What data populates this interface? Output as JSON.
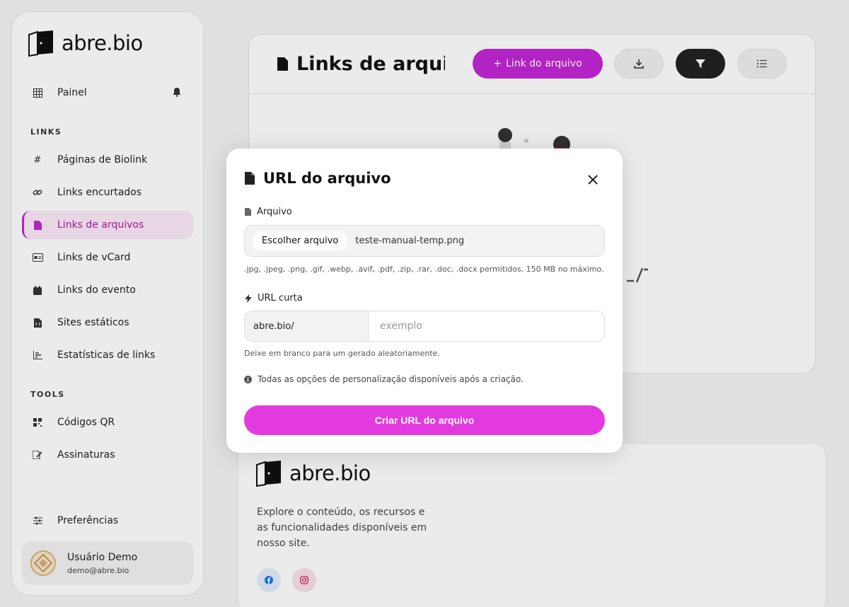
{
  "brand": {
    "name": "abre.bio",
    "accent": "#c026d3"
  },
  "sidebar": {
    "dashboard": "Painel",
    "links_section": "LINKS",
    "links_items": [
      {
        "label": "Páginas de Biolink",
        "icon": "hash-icon"
      },
      {
        "label": "Links encurtados",
        "icon": "link-icon"
      },
      {
        "label": "Links de arquivos",
        "icon": "file-icon"
      },
      {
        "label": "Links de vCard",
        "icon": "id-card-icon"
      },
      {
        "label": "Links do evento",
        "icon": "calendar-icon"
      },
      {
        "label": "Sites estáticos",
        "icon": "file-code-icon"
      },
      {
        "label": "Estatísticas de links",
        "icon": "chart-icon"
      }
    ],
    "tools_section": "TOOLS",
    "tools_items": [
      {
        "label": "Códigos QR",
        "icon": "qr-icon"
      },
      {
        "label": "Assinaturas",
        "icon": "signature-icon"
      }
    ],
    "preferences": "Preferências",
    "user": {
      "name": "Usuário Demo",
      "email": "demo@abre.bio"
    }
  },
  "main": {
    "title": "Links de arqui...",
    "add_button": "Link do arquivo"
  },
  "footer": {
    "description": "Explore o conteúdo, os recursos e as funcionalidades disponíveis em nosso site."
  },
  "modal": {
    "title": "URL do arquivo",
    "file_label": "Arquivo",
    "file_button": "Escolher arquivo",
    "file_name": "teste-manual-temp.png",
    "file_help": ".jpg, .jpeg, .png, .gif, .webp, .avif, .pdf, .zip, .rar, .doc, .docx permitidos. 150 MB no máximo.",
    "url_label": "URL curta",
    "url_prefix": "abre.bio/",
    "url_placeholder": "exemplo",
    "url_help": "Deixe em branco para um gerado aleatoriamente.",
    "info": "Todas as opções de personalização disponíveis após a criação.",
    "submit": "Criar URL do arquivo"
  }
}
